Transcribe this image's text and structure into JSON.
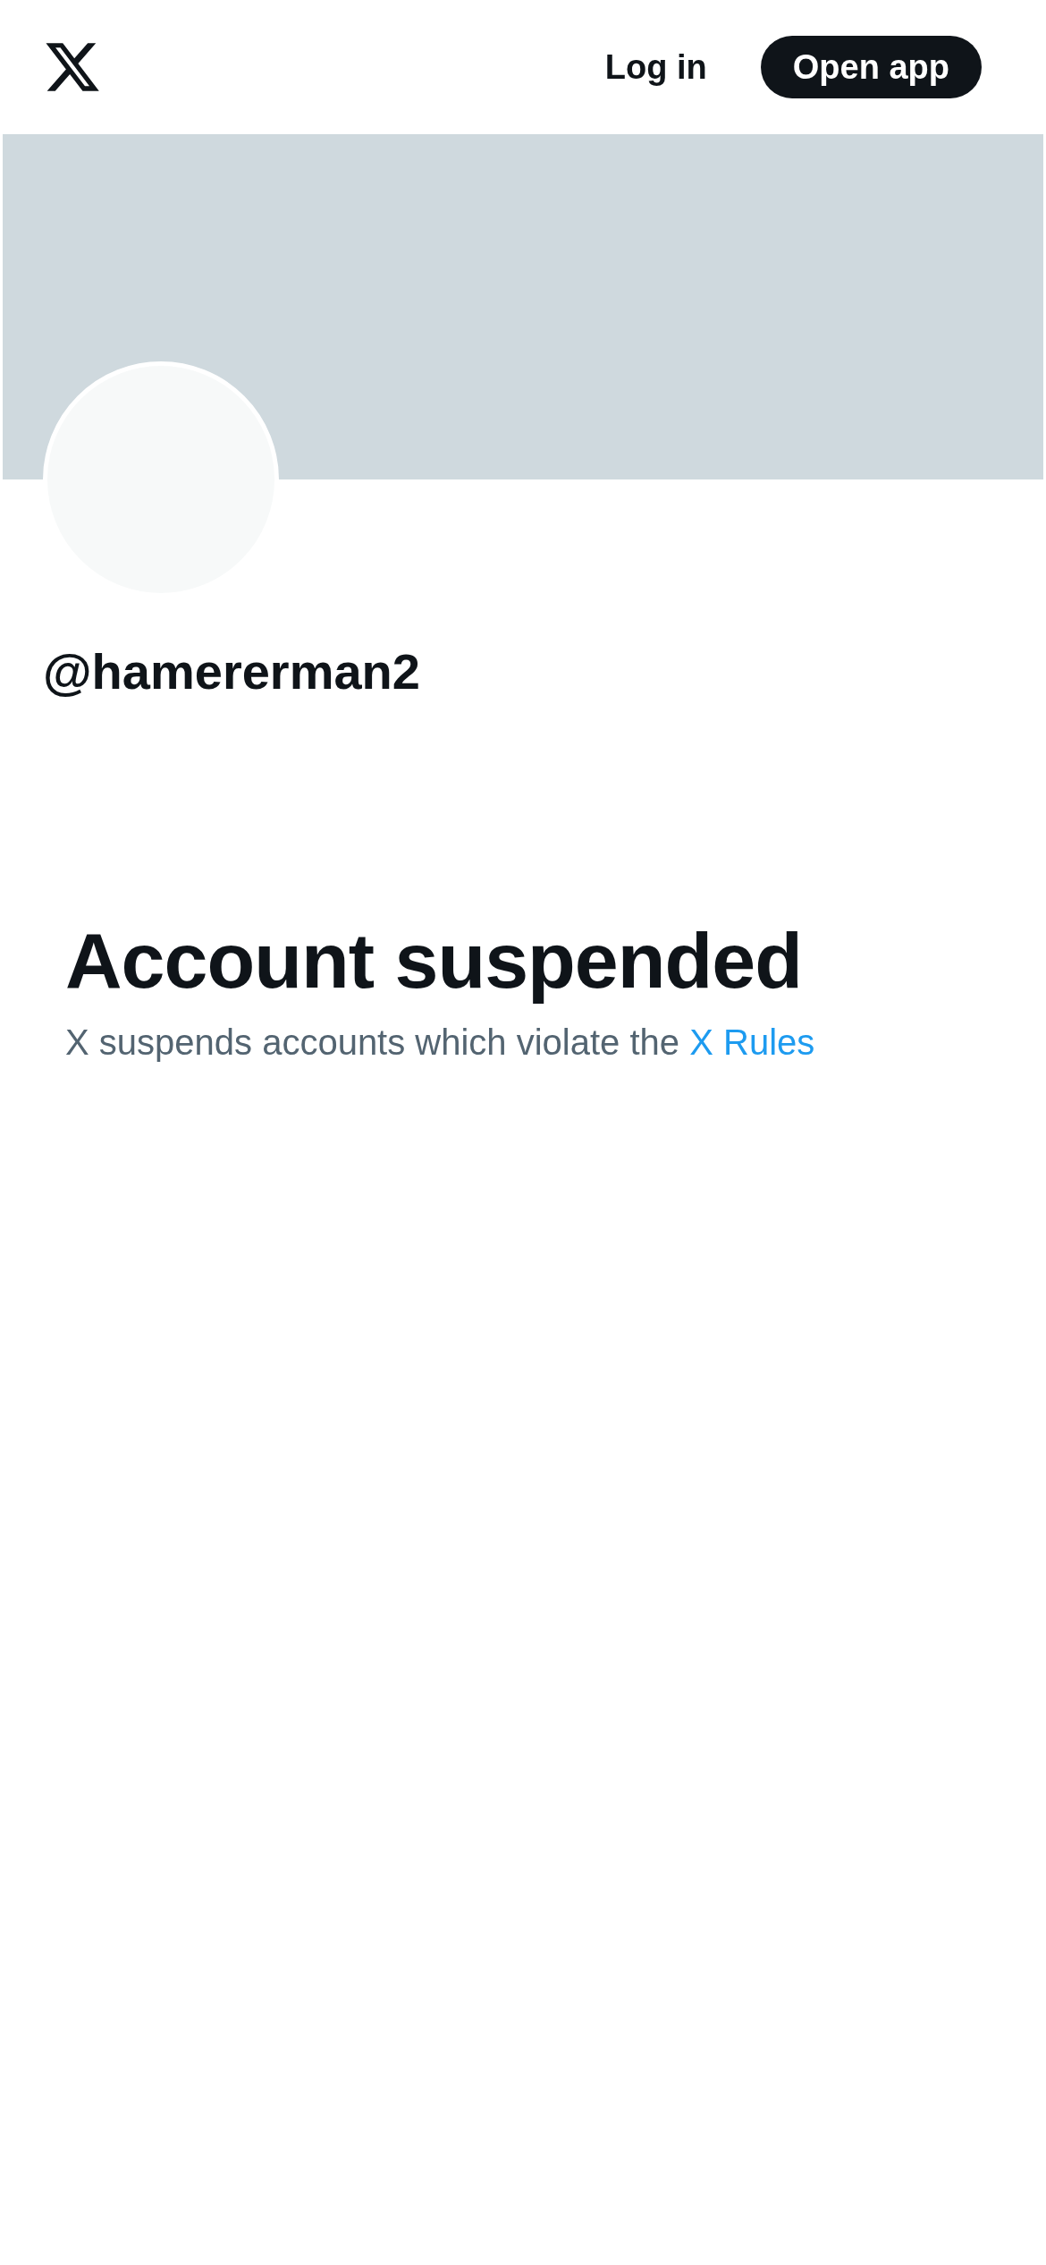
{
  "header": {
    "log_in": "Log in",
    "open_app": "Open app"
  },
  "profile": {
    "handle": "@hamererman2"
  },
  "notice": {
    "title": "Account suspended",
    "text": "X suspends accounts which violate the",
    "link": "X Rules"
  }
}
